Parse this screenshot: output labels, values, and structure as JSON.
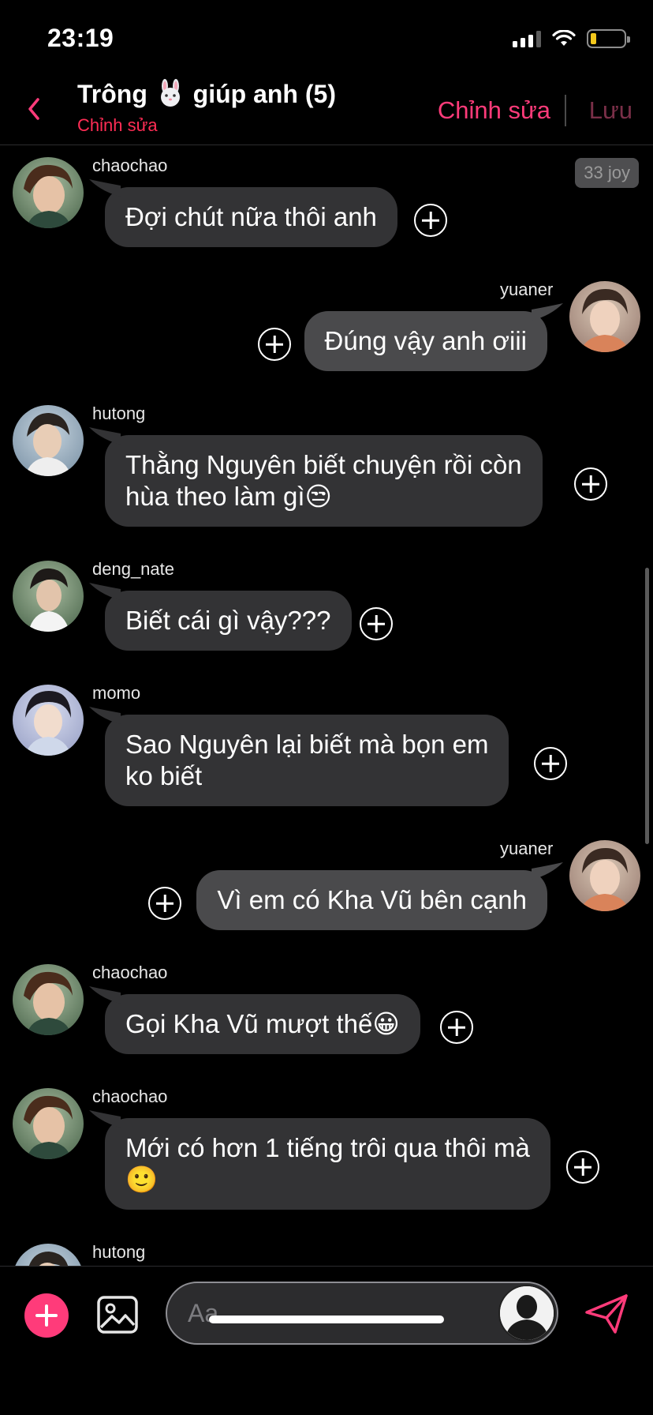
{
  "status_bar": {
    "time": "23:19"
  },
  "header": {
    "title_prefix": "Trông",
    "title_emoji": "rabbit-face-icon",
    "title_suffix": "giúp anh (5)",
    "subtitle": "Chỉnh sửa",
    "edit_label": "Chỉnh sửa",
    "save_label": "Lưu"
  },
  "badge": {
    "text": "33 joy"
  },
  "messages": [
    {
      "user": "chaochao",
      "side": "left",
      "text": "Đợi chút nữa thôi anh"
    },
    {
      "user": "yuaner",
      "side": "right",
      "text": "Đúng vậy anh ơiii"
    },
    {
      "user": "hutong",
      "side": "left",
      "text_line1": "Thằng Nguyên biết chuyện rồi còn",
      "text_line2": "hùa theo làm gì😒"
    },
    {
      "user": "deng_nate",
      "side": "left",
      "text": "Biết cái gì vậy???"
    },
    {
      "user": "momo",
      "side": "left",
      "text_line1": "Sao Nguyên lại biết mà bọn em",
      "text_line2": "ko biết"
    },
    {
      "user": "yuaner",
      "side": "right",
      "text": "Vì em có Kha Vũ bên cạnh"
    },
    {
      "user": "chaochao",
      "side": "left",
      "text": "Gọi Kha Vũ mượt thế😀"
    },
    {
      "user": "chaochao",
      "side": "left",
      "text_line1": "Mới có hơn 1 tiếng trôi qua thôi mà",
      "text_line2": "🙂"
    },
    {
      "user": "hutong",
      "side": "left",
      "text": ""
    }
  ],
  "composer": {
    "placeholder": "Aa"
  },
  "colors": {
    "accent": "#ff3b7a",
    "bubble": "#333335",
    "bubble_right": "#4a4a4c",
    "background": "#000000"
  }
}
